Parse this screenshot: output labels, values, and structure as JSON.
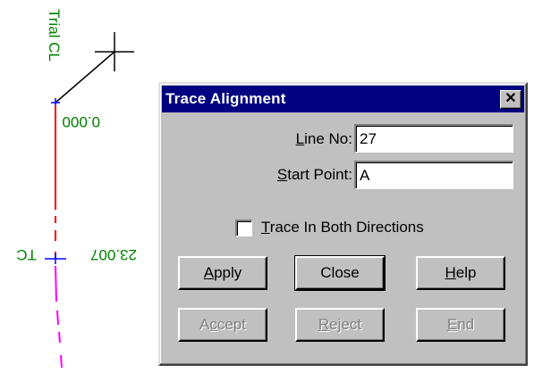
{
  "canvas": {
    "vertical_label": "Trial CL",
    "station_start": "0.000",
    "station_tc": "23.007",
    "tc_label": "TC",
    "colors": {
      "label_green": "#008000",
      "line_red": "#ff0000",
      "line_magenta": "#ff00ff",
      "line_black": "#000000",
      "marker_blue": "#0000ff"
    }
  },
  "dialog": {
    "title": "Trace Alignment",
    "close_glyph": "✕",
    "line_no": {
      "label": "Line No:",
      "value": "27"
    },
    "start_point": {
      "label": "Start Point:",
      "value": "A"
    },
    "trace_both": {
      "label": "Trace In Both Directions",
      "checked": false
    },
    "buttons_row1": [
      "Apply",
      "Close",
      "Help"
    ],
    "buttons_row2": [
      "Accept",
      "Reject",
      "End"
    ],
    "colors": {
      "titlebar": "#000080",
      "face": "#c0c0c0"
    }
  }
}
